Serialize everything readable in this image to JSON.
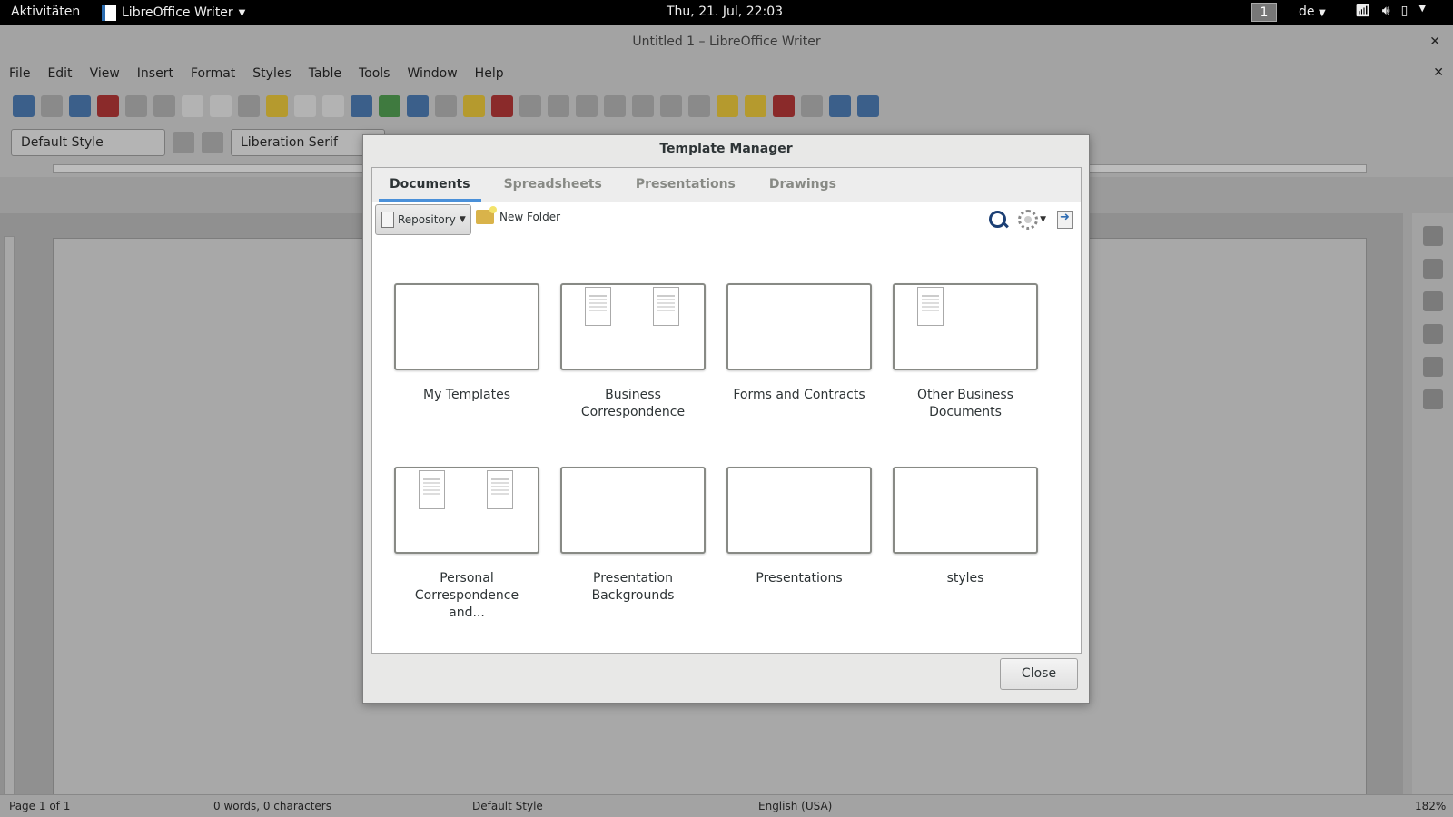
{
  "topbar": {
    "activities": "Aktivitäten",
    "app_name": "LibreOffice Writer",
    "clock": "Thu, 21. Jul, 22:03",
    "workspace": "1",
    "language": "de"
  },
  "window": {
    "title": "Untitled 1 – LibreOffice Writer",
    "menu": [
      "File",
      "Edit",
      "View",
      "Insert",
      "Format",
      "Styles",
      "Table",
      "Tools",
      "Window",
      "Help"
    ],
    "paragraph_style": "Default Style",
    "font_name": "Liberation Serif"
  },
  "statusbar": {
    "page": "Page 1 of 1",
    "words": "0 words, 0 characters",
    "style": "Default Style",
    "language": "English (USA)",
    "zoom": "182%"
  },
  "dialog": {
    "title": "Template Manager",
    "tabs": [
      "Documents",
      "Spreadsheets",
      "Presentations",
      "Drawings"
    ],
    "active_tab": "Documents",
    "repository_label": "Repository",
    "new_folder_label": "New Folder",
    "folders": [
      {
        "name": "My Templates",
        "thumbs": 0
      },
      {
        "name": "Business Correspondence",
        "thumbs": 2
      },
      {
        "name": "Forms and Contracts",
        "thumbs": 0
      },
      {
        "name": "Other Business Documents",
        "thumbs": 1
      },
      {
        "name": "Personal Correspondence and...",
        "thumbs": 2
      },
      {
        "name": "Presentation Backgrounds",
        "thumbs": 0
      },
      {
        "name": "Presentations",
        "thumbs": 0
      },
      {
        "name": "styles",
        "thumbs": 0
      }
    ],
    "close_label": "Close"
  }
}
